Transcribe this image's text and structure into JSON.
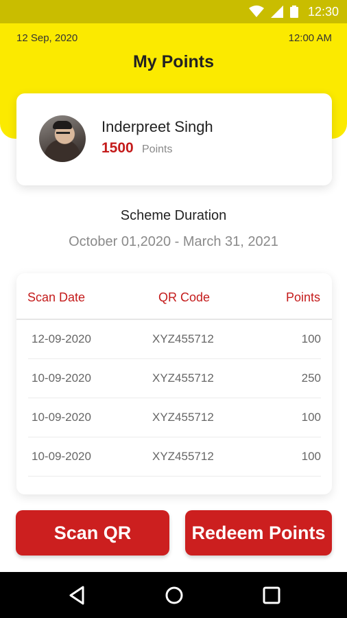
{
  "status_bar": {
    "time": "12:30"
  },
  "header": {
    "date": "12 Sep, 2020",
    "time": "12:00 AM",
    "title": "My Points"
  },
  "profile": {
    "name": "Inderpreet Singh",
    "points": "1500",
    "points_unit": "Points"
  },
  "scheme": {
    "title": "Scheme Duration",
    "dates": "October 01,2020 - March 31, 2021"
  },
  "table": {
    "columns": [
      "Scan Date",
      "QR Code",
      "Points"
    ],
    "rows": [
      {
        "date": "12-09-2020",
        "code": "XYZ455712",
        "points": "100"
      },
      {
        "date": "10-09-2020",
        "code": "XYZ455712",
        "points": "250"
      },
      {
        "date": "10-09-2020",
        "code": "XYZ455712",
        "points": "100"
      },
      {
        "date": "10-09-2020",
        "code": "XYZ455712",
        "points": "100"
      }
    ]
  },
  "buttons": {
    "scan": "Scan QR",
    "redeem": "Redeem Points"
  },
  "colors": {
    "header_yellow": "#fbea00",
    "status_bar": "#c9bd00",
    "accent_red": "#c41b1b",
    "button_red": "#cc1f1f"
  },
  "icons": [
    "wifi-icon",
    "signal-icon",
    "battery-icon",
    "back-icon",
    "home-icon",
    "recent-apps-icon",
    "avatar"
  ]
}
